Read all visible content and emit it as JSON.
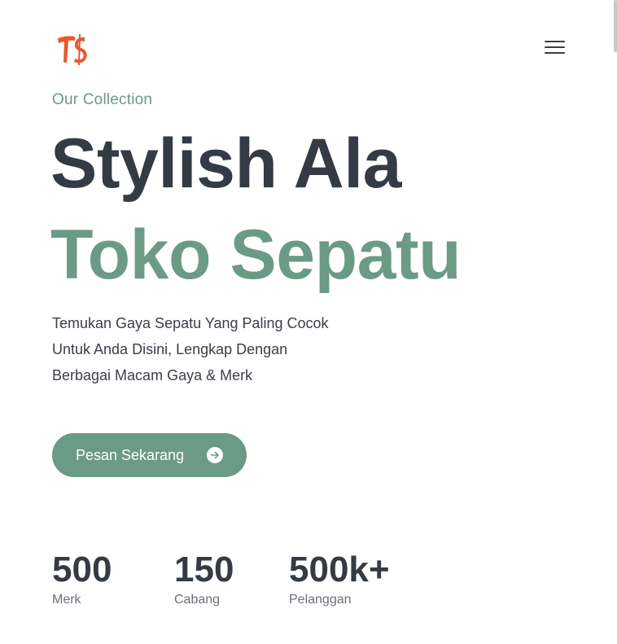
{
  "header": {
    "logo_text": "TS",
    "logo_color": "#e8582a",
    "menu_icon": "hamburger-menu-icon"
  },
  "hero": {
    "eyebrow": "Our Collection",
    "headline_line1": "Stylish Ala",
    "headline_line2": "Toko Sepatu",
    "description_lines": [
      "Temukan Gaya Sepatu Yang Paling Cocok",
      "Untuk Anda Disini, Lengkap Dengan",
      "Berbagai Macam Gaya & Merk"
    ],
    "cta": {
      "label": "Pesan Sekarang",
      "icon": "arrow-right-circle-icon"
    }
  },
  "stats": [
    {
      "value": "500",
      "label": "Merk"
    },
    {
      "value": "150",
      "label": "Cabang"
    },
    {
      "value": "500k+",
      "label": "Pelanggan"
    }
  ],
  "colors": {
    "accent": "#6b9a86",
    "heading": "#353b44",
    "text": "#3a3f47",
    "muted": "#6b7078",
    "logo": "#e8582a"
  }
}
